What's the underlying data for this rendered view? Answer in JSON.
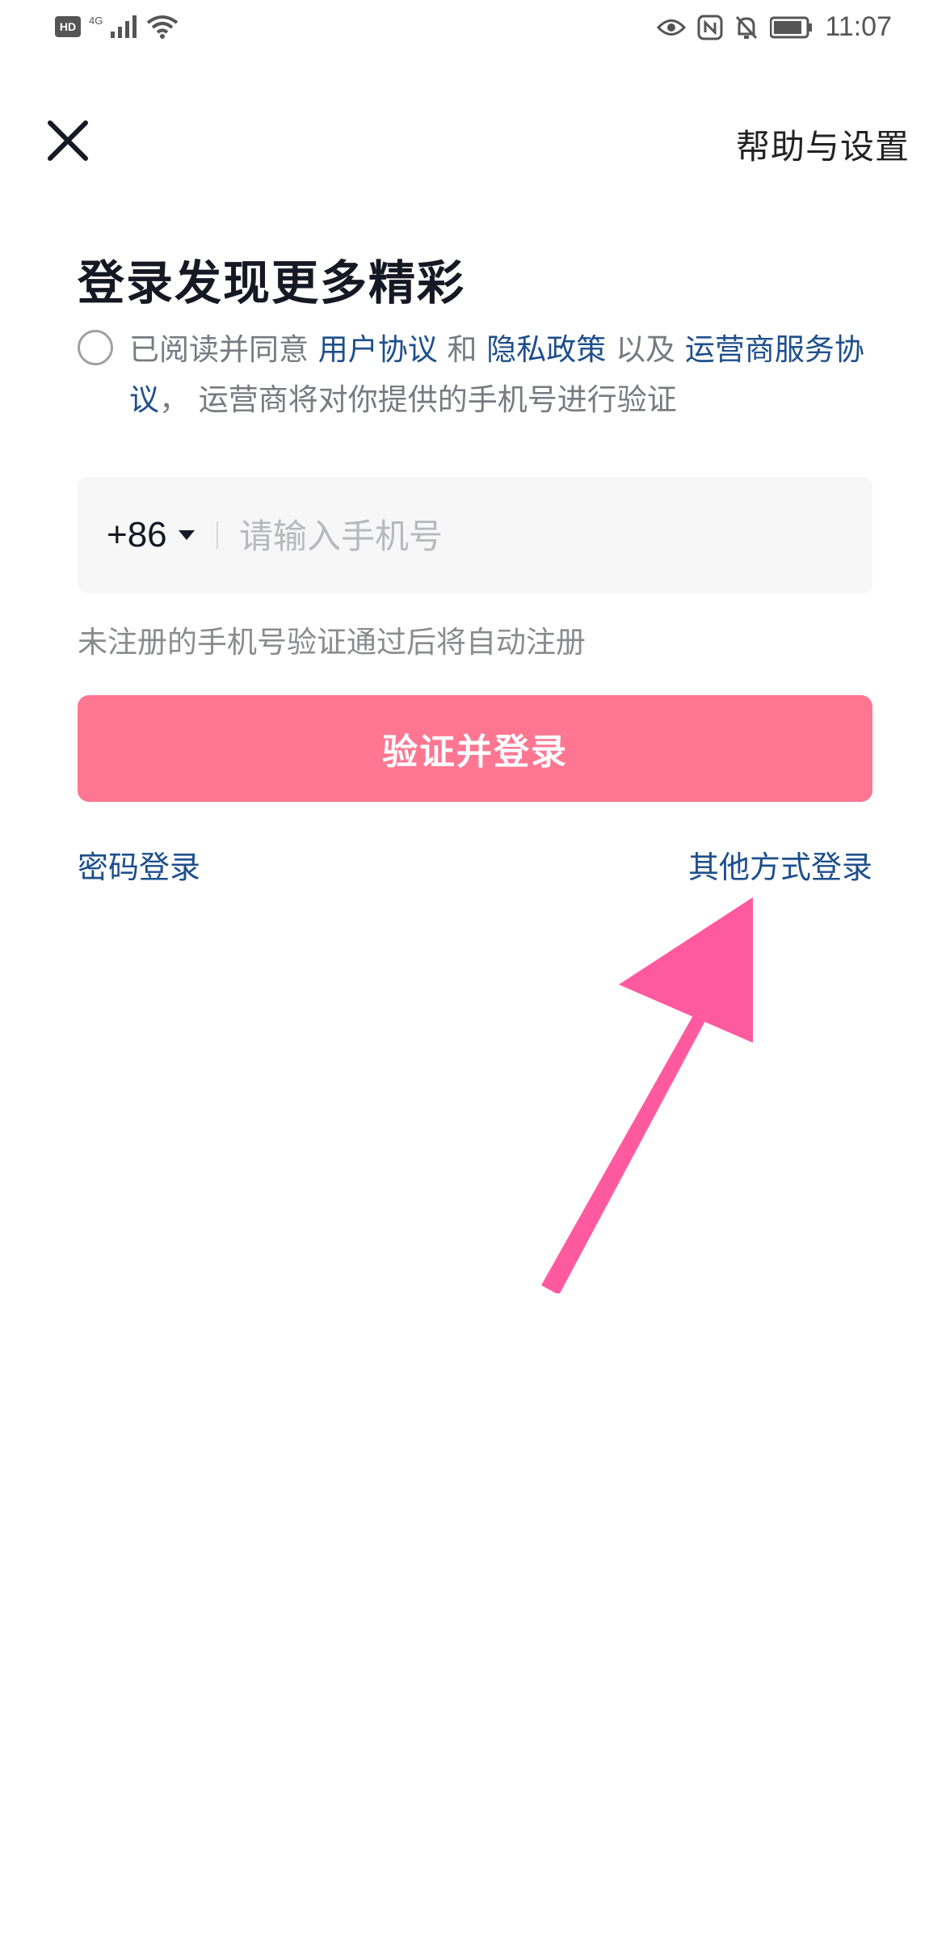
{
  "status_bar": {
    "hd_badge": "HD",
    "network": "4G",
    "time": "11:07",
    "icons": [
      "signal-icon",
      "wifi-icon",
      "eye-icon",
      "nfc-icon",
      "bell-off-icon",
      "battery-icon"
    ]
  },
  "header": {
    "close_icon": "close-icon",
    "help_label": "帮助与设置"
  },
  "title": "登录发现更多精彩",
  "agreement": {
    "checked": false,
    "prefix": "已阅读并同意 ",
    "user_agreement": "用户协议",
    "and": " 和 ",
    "privacy_policy": "隐私政策",
    "and_also": " 以及 ",
    "carrier_service": "运营商服务协议",
    "suffix": "， 运营商将对你提供的手机号进行验证"
  },
  "phone": {
    "country_code": "+86",
    "placeholder": "请输入手机号",
    "value": ""
  },
  "hint": "未注册的手机号验证通过后将自动注册",
  "submit_label": "验证并登录",
  "password_login": "密码登录",
  "other_login": "其他方式登录",
  "colors": {
    "accent": "#fe7691",
    "link": "#1e4f8c",
    "arrow": "#ff5aa0",
    "title": "#161823"
  }
}
